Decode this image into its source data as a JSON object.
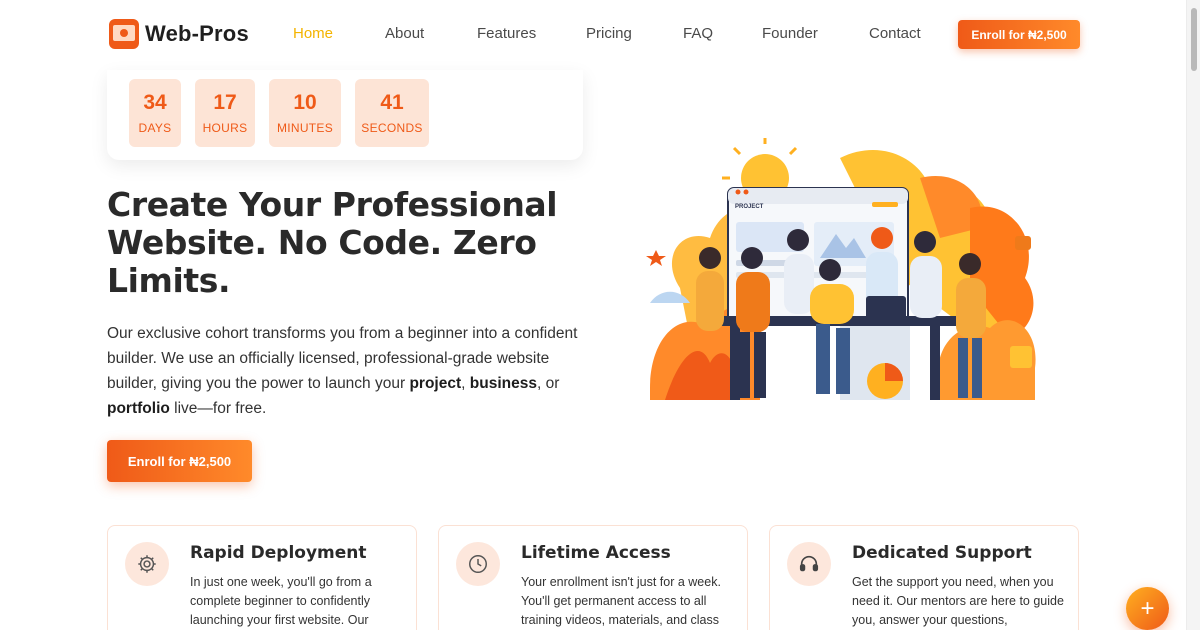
{
  "brand": {
    "name": "Web-Pros"
  },
  "nav": {
    "links": [
      "Home",
      "About",
      "Features",
      "Pricing",
      "FAQ",
      "Founder",
      "Contact"
    ],
    "active": "Home",
    "cta_label": "Enroll for ₦2,500"
  },
  "countdown": [
    {
      "value": "34",
      "label": "DAYS"
    },
    {
      "value": "17",
      "label": "HOURS"
    },
    {
      "value": "10",
      "label": "MINUTES"
    },
    {
      "value": "41",
      "label": "SECONDS"
    }
  ],
  "hero": {
    "title": "Create Your Professional Website. No Code. Zero Limits.",
    "text_1": "Our exclusive cohort transforms you from a beginner into a confident builder. We use an officially licensed, professional-grade website builder, giving you the power to launch your ",
    "bold_project": "project",
    "comma_1": ", ",
    "bold_business": "business",
    "comma_2": ", or",
    "bold_portfolio": "portfolio",
    "text_2": " live—for free.",
    "cta_label": "Enroll for ₦2,500",
    "illustration_sign": "PROJECT"
  },
  "features": [
    {
      "icon": "gear-icon",
      "title": "Rapid Deployment",
      "text": "In just one week, you'll go from a complete beginner to confidently launching your first website. Our"
    },
    {
      "icon": "clock-icon",
      "title": "Lifetime Access",
      "text": "Your enrollment isn't just for a week. You'll get permanent access to all training videos, materials, and class"
    },
    {
      "icon": "headset-icon",
      "title": "Dedicated Support",
      "text": "Get the support you need, when you need it. Our mentors are here to guide you, answer your questions,"
    }
  ],
  "fab": {
    "label": "+"
  },
  "colors": {
    "accent": "#ef5a18",
    "accent_light": "#fde4d6",
    "nav_active": "#f4b400",
    "text": "#2a2a2a"
  }
}
